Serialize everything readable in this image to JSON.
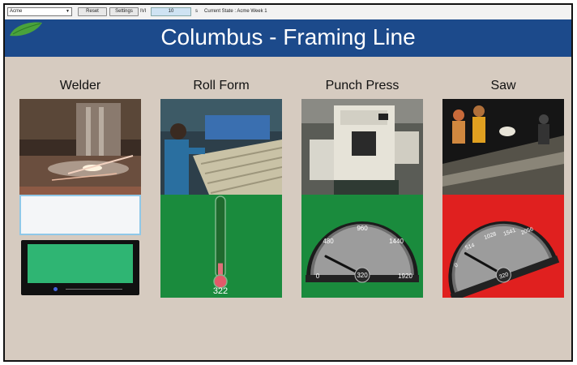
{
  "toolbar": {
    "site_select": "Acme",
    "reset_label": "Reset",
    "settings_label": "Settings",
    "interval_label": "IVI",
    "interval_value": "10",
    "seconds_label": "s",
    "current_state": "Current State : Acme Week 1"
  },
  "header": {
    "title": "Columbus - Framing Line"
  },
  "stations": [
    {
      "name": "Welder"
    },
    {
      "name": "Roll Form",
      "thermometer_value": "322"
    },
    {
      "name": "Punch Press",
      "gauge": {
        "value": "320",
        "ticks": [
          "0",
          "480",
          "960",
          "1440",
          "1920"
        ]
      }
    },
    {
      "name": "Saw",
      "gauge": {
        "value": "320",
        "ticks": [
          "0",
          "514",
          "1028",
          "1541",
          "2056"
        ]
      }
    }
  ],
  "colors": {
    "header": "#1c4a8b",
    "background": "#d6cbc0",
    "status_green": "#1a8b3d",
    "status_red": "#e0201f",
    "welder_status": "#2fb573"
  }
}
